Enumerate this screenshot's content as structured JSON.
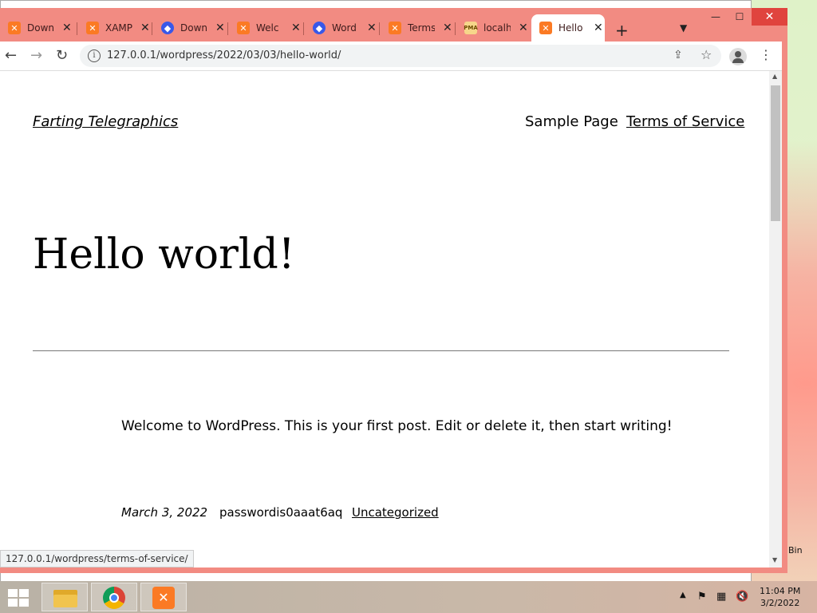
{
  "browser": {
    "tabs": [
      {
        "title": "Down",
        "favicon": "xampp-icon"
      },
      {
        "title": "XAMP",
        "favicon": "xampp-icon"
      },
      {
        "title": "Down",
        "favicon": "wordpress-icon"
      },
      {
        "title": "Welc",
        "favicon": "xampp-icon"
      },
      {
        "title": "Word",
        "favicon": "wordpress-icon"
      },
      {
        "title": "Terms",
        "favicon": "xampp-icon"
      },
      {
        "title": "localh",
        "favicon": "phpmyadmin-icon"
      },
      {
        "title": "Hello",
        "favicon": "xampp-icon",
        "active": true
      }
    ],
    "url": "127.0.0.1/wordpress/2022/03/03/hello-world/",
    "status_url": "127.0.0.1/wordpress/terms-of-service/",
    "accent_color": "#f28b82"
  },
  "page": {
    "site_title": "Farting Telegraphics",
    "nav": {
      "sample_page": "Sample Page",
      "terms": "Terms of Service"
    },
    "post_title": "Hello world!",
    "post_content": "Welcome to WordPress. This is your first post. Edit or delete it, then start writing!",
    "post_date": "March 3, 2022",
    "post_author": "passwordis0aaat6aq",
    "post_category": "Uncategorized"
  },
  "desktop": {
    "recycle_bin_label": "Bin"
  },
  "taskbar": {
    "time": "11:04 PM",
    "date": "3/2/2022"
  }
}
